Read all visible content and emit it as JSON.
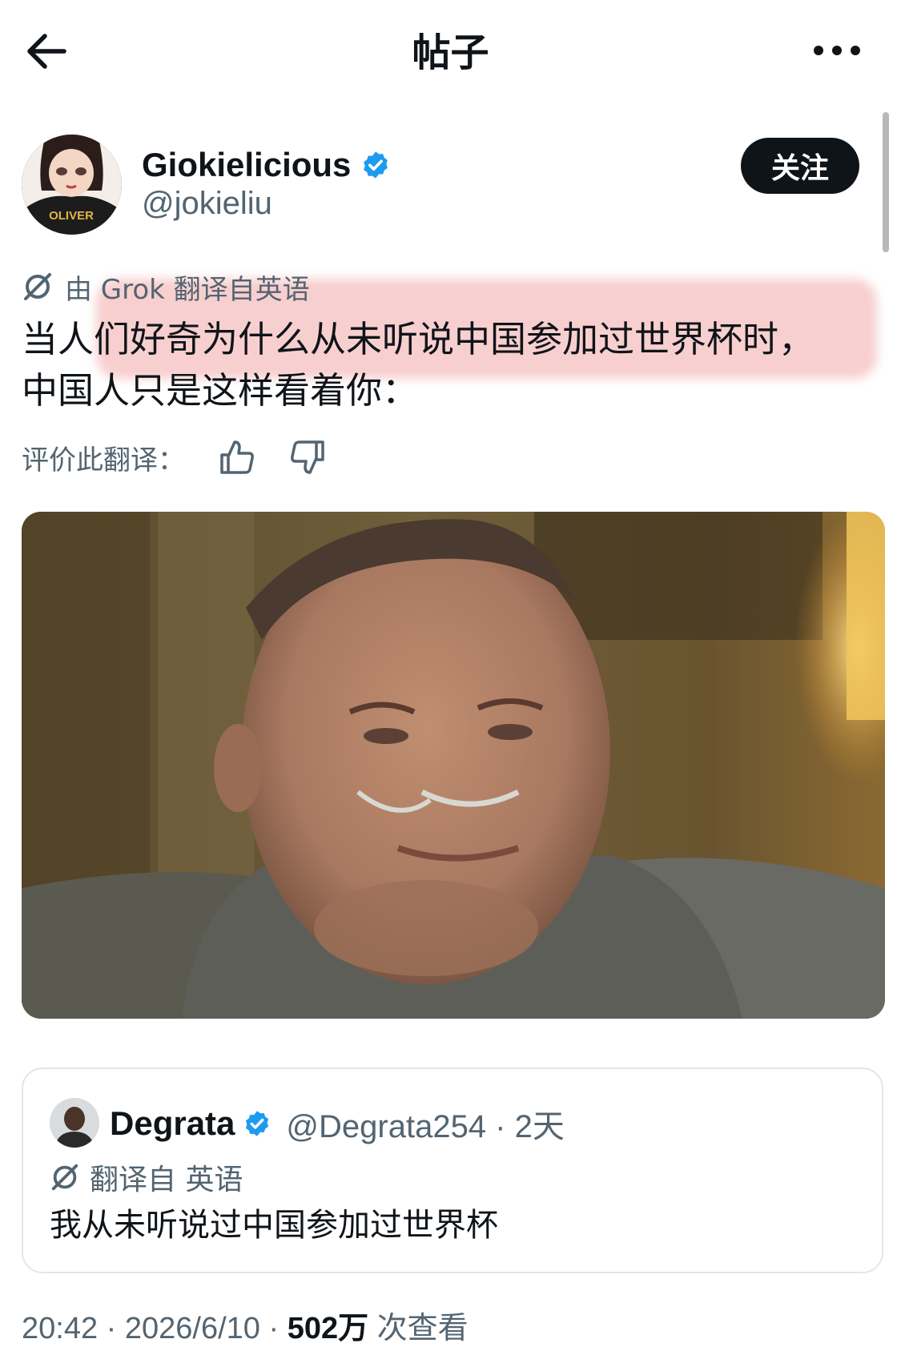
{
  "header": {
    "title": "帖子"
  },
  "author": {
    "name": "Giokielicious",
    "handle": "@jokieliu",
    "verified": true,
    "avatar_text": "OLIVER"
  },
  "follow_button": {
    "label": "关注"
  },
  "translation": {
    "notice": "由 Grok 翻译自英语"
  },
  "post": {
    "text_line1": "当人们好奇为什么从未听说中国参加过世界杯时，",
    "text_line2": "中国人只是这样看着你："
  },
  "rate_translation": {
    "label": "评价此翻译："
  },
  "quote": {
    "name": "Degrata",
    "handle_time": "@Degrata254 · 2天",
    "translation_label": "翻译自 英语",
    "text": "我从未听说过中国参加过世界杯"
  },
  "meta": {
    "time_date": "20:42 · 2026/6/10 · ",
    "views": "502万",
    "views_label": " 次查看"
  },
  "colors": {
    "accent": "#1d9bf0",
    "text": "#0f1419",
    "secondary": "#536471",
    "highlight": "#ee8c8c"
  },
  "icons": [
    "back-arrow-icon",
    "more-icon",
    "verified-badge-icon",
    "grok-icon",
    "thumbs-up-icon",
    "thumbs-down-icon"
  ]
}
